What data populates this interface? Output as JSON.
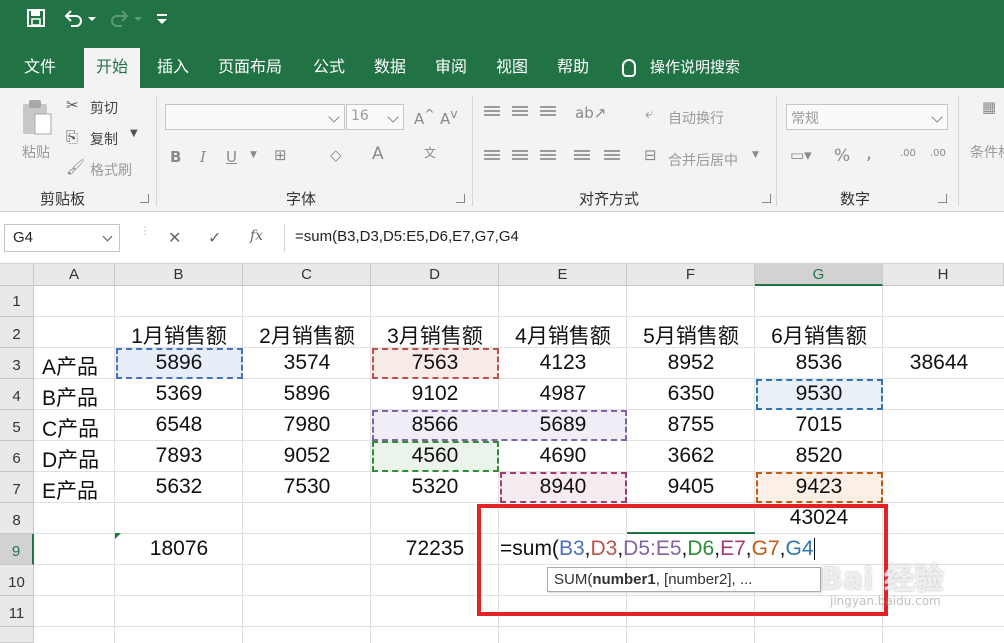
{
  "colors": {
    "excel_green": "#217346",
    "red_box": "#e32228"
  },
  "qat": {
    "save_icon": "save-icon",
    "undo_icon": "undo-icon",
    "redo_icon": "redo-icon",
    "customize_icon": "customize-icon"
  },
  "tabs": [
    {
      "label": "文件"
    },
    {
      "label": "开始"
    },
    {
      "label": "插入"
    },
    {
      "label": "页面布局"
    },
    {
      "label": "公式"
    },
    {
      "label": "数据"
    },
    {
      "label": "审阅"
    },
    {
      "label": "视图"
    },
    {
      "label": "帮助"
    }
  ],
  "tell_me": "操作说明搜索",
  "ribbon": {
    "clipboard": {
      "paste": "粘贴",
      "cut": "剪切",
      "copy": "复制",
      "format_painter": "格式刷",
      "group": "剪贴板"
    },
    "font": {
      "font_name": "",
      "font_size": "16",
      "group": "字体",
      "bold": "B",
      "italic": "I",
      "underline": "U"
    },
    "align": {
      "wrap": "自动换行",
      "merge": "合并后居中",
      "group": "对齐方式"
    },
    "number": {
      "format": "常规",
      "group": "数字",
      "percent": "%",
      "comma": ",",
      "inc_dec": ".00",
      "dec_dec": ".00"
    },
    "styles": {
      "cond": "条件格"
    }
  },
  "formula_bar": {
    "name_box": "G4",
    "fx": "fx",
    "formula": "=sum(B3,D3,D5:E5,D6,E7,G7,G4"
  },
  "columns": [
    "A",
    "B",
    "C",
    "D",
    "E",
    "F",
    "G",
    "H"
  ],
  "rows": [
    "1",
    "2",
    "3",
    "4",
    "5",
    "6",
    "7",
    "8",
    "9",
    "10",
    "11"
  ],
  "table": {
    "headers": [
      "1月销售额",
      "2月销售额",
      "3月销售额",
      "4月销售额",
      "5月销售额",
      "6月销售额"
    ],
    "row_labels": [
      "A产品",
      "B产品",
      "C产品",
      "D产品",
      "E产品"
    ],
    "values": [
      [
        "5896",
        "3574",
        "7563",
        "4123",
        "8952",
        "8536"
      ],
      [
        "5369",
        "5896",
        "9102",
        "4987",
        "6350",
        "9530"
      ],
      [
        "6548",
        "7980",
        "8566",
        "5689",
        "8755",
        "7015"
      ],
      [
        "7893",
        "9052",
        "4560",
        "4690",
        "3662",
        "8520"
      ],
      [
        "5632",
        "7530",
        "5320",
        "8940",
        "9405",
        "9423"
      ]
    ],
    "h3": "38644",
    "g8": "43024",
    "b9": "18076",
    "d9": "72235"
  },
  "editor": {
    "prefix": "=sum(",
    "refs": [
      {
        "text": "B3",
        "color": "#4472c4"
      },
      {
        "text": "D3",
        "color": "#c0504d"
      },
      {
        "text": "D5:E5",
        "color": "#8064a2"
      },
      {
        "text": "D6",
        "color": "#2e8b3a"
      },
      {
        "text": "E7",
        "color": "#a23b72"
      },
      {
        "text": "G7",
        "color": "#c55a11"
      },
      {
        "text": "G4",
        "color": "#2e75b6"
      }
    ],
    "tooltip_fn": "SUM(",
    "tooltip_arg1": "number1",
    "tooltip_rest": ", [number2], ..."
  },
  "watermark": {
    "text": "Bai 经验",
    "sub": "jingyan.baidu.com"
  }
}
